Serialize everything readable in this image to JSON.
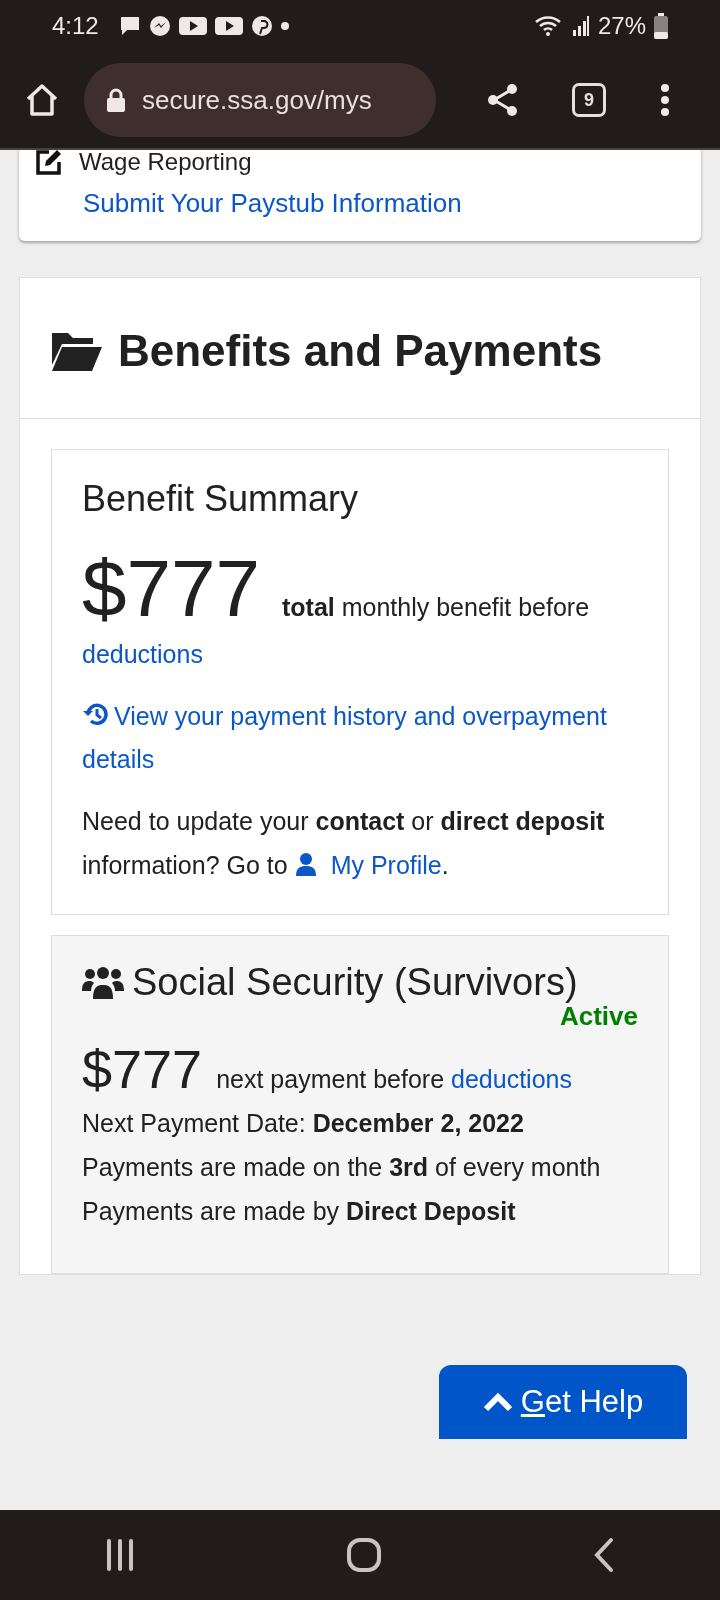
{
  "status_bar": {
    "time": "4:12",
    "battery": "27%"
  },
  "browser": {
    "url": "secure.ssa.gov/mys",
    "tab_count": "9"
  },
  "wage_card": {
    "title": "Wage Reporting",
    "link": "Submit Your Paystub Information"
  },
  "section": {
    "title": "Benefits and Payments"
  },
  "summary": {
    "title": "Benefit Summary",
    "amount": "$777",
    "amount_text": "**total** monthly benefit before ",
    "amount_link": "deductions",
    "history_link": "View your payment history and overpayment details",
    "profile_text": "Need to update your **contact** or **direct deposit** information? Go to ",
    "profile_link": "My Profile",
    "profile_end": "."
  },
  "benefit": {
    "title": "Social Security (Survivors)",
    "status": "Active",
    "amount": "$777",
    "amount_text": "next payment before ",
    "amount_link": "deductions",
    "lines": [
      "Next Payment Date: **December 2, 2022**",
      "Payments are made on the **3rd** of every month",
      "Payments are made by **Direct Deposit**"
    ]
  },
  "get_help": {
    "label": "Get Help"
  }
}
